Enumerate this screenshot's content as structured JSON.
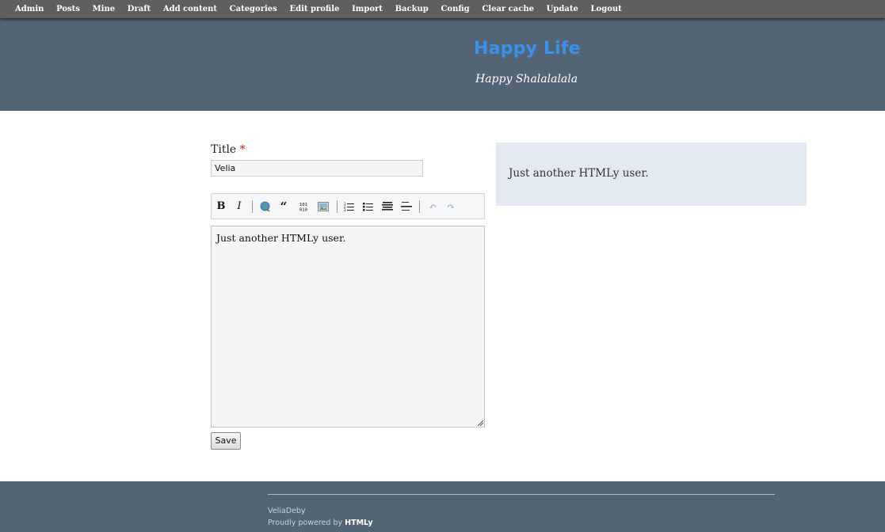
{
  "adminbar": {
    "items": [
      "Admin",
      "Posts",
      "Mine",
      "Draft",
      "Add content",
      "Categories",
      "Edit profile",
      "Import",
      "Backup",
      "Config",
      "Clear cache",
      "Update",
      "Logout"
    ]
  },
  "header": {
    "title": "Happy Life",
    "tagline": "Happy Shalalalala"
  },
  "form": {
    "title_label": "Title",
    "required_mark": "*",
    "title_value": "Velia",
    "editor_text": "Just another HTMLy user.",
    "save_label": "Save"
  },
  "toolbar": {
    "buttons": [
      "bold-icon",
      "italic-icon",
      "link-icon",
      "quote-icon",
      "code-icon",
      "image-icon",
      "ordered-list-icon",
      "unordered-list-icon",
      "heading-icon",
      "horizontal-rule-icon",
      "undo-icon",
      "redo-icon"
    ]
  },
  "preview": {
    "text": "Just another HTMLy user."
  },
  "footer": {
    "author": "VeliaDeby",
    "powered_prefix": "Proudly powered by",
    "powered_link": "HTMLy"
  },
  "colors": {
    "adminbar": "#5f5f5f",
    "header": "#536574",
    "title": "#3a92ee",
    "preview_bg": "#e3e9f0"
  }
}
